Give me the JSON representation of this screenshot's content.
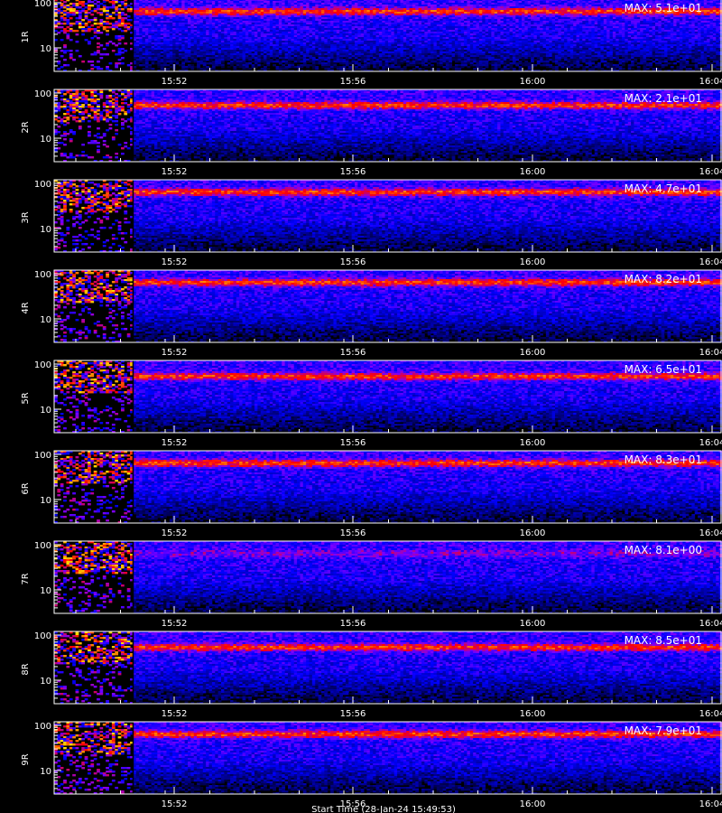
{
  "chart_data": {
    "type": "heatmap",
    "x_ticks": [
      "15:52",
      "15:56",
      "16:00",
      "16:04"
    ],
    "y_ticks": [
      "10",
      "100"
    ],
    "y_scale": "log",
    "x_label": "Start Time (28-Jan-24 15:49:53)",
    "colormap": [
      "#000000",
      "#00008b",
      "#0000ff",
      "#7f00ff",
      "#ff0000",
      "#ff8c00",
      "#ffff00"
    ],
    "panels": [
      {
        "label": "1R",
        "max_label": "MAX: 5.1e+01",
        "max_value": 51.0
      },
      {
        "label": "2R",
        "max_label": "MAX: 2.1e+01",
        "max_value": 21.0
      },
      {
        "label": "3R",
        "max_label": "MAX: 4.7e+01",
        "max_value": 47.0
      },
      {
        "label": "4R",
        "max_label": "MAX: 8.2e+01",
        "max_value": 82.0
      },
      {
        "label": "5R",
        "max_label": "MAX: 6.5e+01",
        "max_value": 65.0
      },
      {
        "label": "6R",
        "max_label": "MAX: 8.3e+01",
        "max_value": 83.0
      },
      {
        "label": "7R",
        "max_label": "MAX: 8.1e+00",
        "max_value": 8.1
      },
      {
        "label": "8R",
        "max_label": "MAX: 8.5e+01",
        "max_value": 85.0
      },
      {
        "label": "9R",
        "max_label": "MAX: 7.9e+01",
        "max_value": 79.0
      }
    ]
  }
}
